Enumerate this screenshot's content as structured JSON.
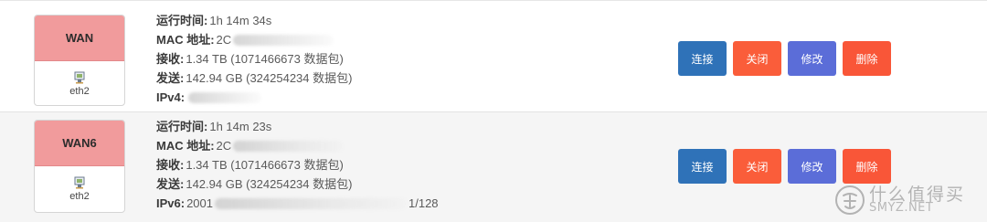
{
  "interfaces": [
    {
      "name": "WAN",
      "device": "eth2",
      "uptime_label": "运行时间:",
      "uptime": "1h 14m 34s",
      "mac_label": "MAC 地址:",
      "mac": "2C",
      "rx_label": "接收:",
      "rx": "1.34 TB (1071466673 数据包)",
      "tx_label": "发送:",
      "tx": "142.94 GB (324254234 数据包)",
      "ip_label": "IPv4:",
      "ip_prefix": "",
      "ip_suffix": "",
      "buttons": {
        "connect": "连接",
        "close": "关闭",
        "edit": "修改",
        "delete": "删除"
      }
    },
    {
      "name": "WAN6",
      "device": "eth2",
      "uptime_label": "运行时间:",
      "uptime": "1h 14m 23s",
      "mac_label": "MAC 地址:",
      "mac": "2C",
      "rx_label": "接收:",
      "rx": "1.34 TB (1071466673 数据包)",
      "tx_label": "发送:",
      "tx": "142.94 GB (324254234 数据包)",
      "ip_label": "IPv6:",
      "ip_prefix": "2001",
      "ip_suffix": "1/128",
      "buttons": {
        "connect": "连接",
        "close": "关闭",
        "edit": "修改",
        "delete": "删除"
      }
    }
  ],
  "colors": {
    "badge_header": "#f19b9c",
    "connect": "#2f72b8",
    "close": "#fa5d3a",
    "edit": "#5b6dd8",
    "delete": "#f95638"
  },
  "watermark": {
    "cn": "什么值得买",
    "en": "SMYZ.NET",
    "icon": "smzdm-logo-icon"
  }
}
